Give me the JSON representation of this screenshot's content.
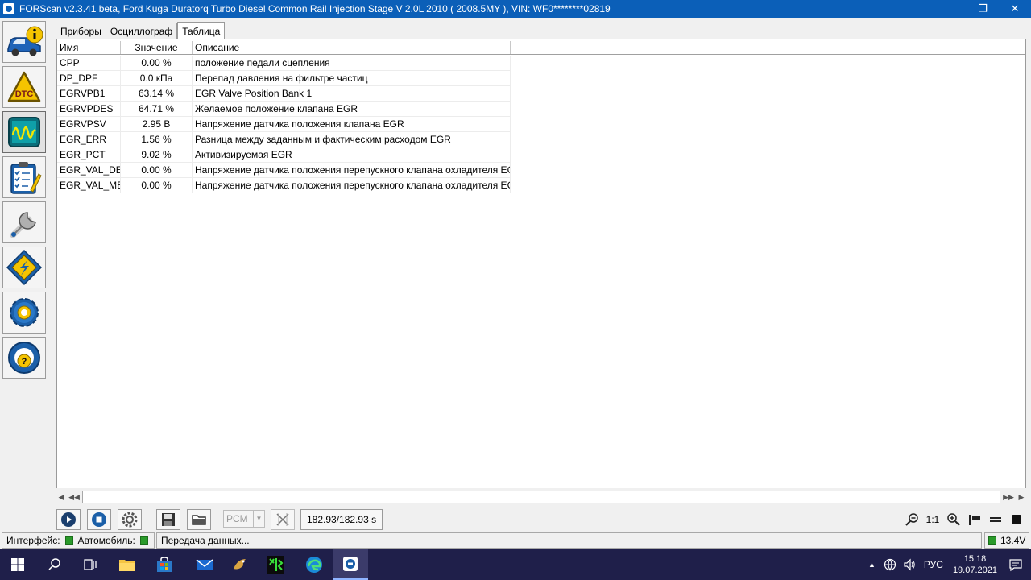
{
  "window": {
    "title": "FORScan v2.3.41 beta, Ford Kuga Duratorq Turbo Diesel Common Rail Injection Stage V 2.0L 2010 ( 2008.5MY ), VIN: WF0********02819",
    "minimize": "–",
    "maximize": "❐",
    "close": "✕"
  },
  "sidebar": {
    "items": [
      {
        "name": "vehicle-info",
        "icon": "car-info-icon"
      },
      {
        "name": "dtc",
        "icon": "dtc-icon",
        "label": "DTC"
      },
      {
        "name": "oscilloscope",
        "icon": "oscilloscope-icon"
      },
      {
        "name": "tests",
        "icon": "checklist-icon"
      },
      {
        "name": "service",
        "icon": "wrench-icon"
      },
      {
        "name": "configuration",
        "icon": "module-chip-icon"
      },
      {
        "name": "settings",
        "icon": "gear-icon"
      },
      {
        "name": "help",
        "icon": "help-icon",
        "label": "?"
      }
    ]
  },
  "tabs": [
    "Приборы",
    "Осциллограф",
    "Таблица"
  ],
  "table": {
    "headers": [
      "Имя",
      "Значение",
      "Описание"
    ],
    "rows": [
      {
        "name": "CPP",
        "value": "0.00 %",
        "desc": "положение педали сцепления"
      },
      {
        "name": "DP_DPF",
        "value": "0.0 кПа",
        "desc": "Перепад давления на фильтре частиц"
      },
      {
        "name": "EGRVPB1",
        "value": "63.14 %",
        "desc": "EGR Valve Position Bank 1"
      },
      {
        "name": "EGRVPDES",
        "value": "64.71 %",
        "desc": "Желаемое положение клапана EGR"
      },
      {
        "name": "EGRVPSV",
        "value": "2.95 В",
        "desc": "Напряжение датчика положения клапана EGR"
      },
      {
        "name": "EGR_ERR",
        "value": "1.56 %",
        "desc": "Разница между заданным и фактическим расходом EGR"
      },
      {
        "name": "EGR_PCT",
        "value": "9.02 %",
        "desc": "Активизируемая EGR"
      },
      {
        "name": "EGR_VAL_DES",
        "value": "0.00 %",
        "desc": "Напряжение датчика положения перепускного клапана охладителя EGR"
      },
      {
        "name": "EGR_VAL_MEA",
        "value": "0.00 %",
        "desc": "Напряжение датчика положения перепускного клапана охладителя EGR"
      }
    ]
  },
  "scrollbar": {
    "left": "◀",
    "rewind": "◀◀",
    "forward": "▶▶",
    "right": "▶"
  },
  "controls": {
    "module_select": "PCM",
    "time_readout": "182.93/182.93 s",
    "zoom_ratio": "1:1"
  },
  "status": {
    "interface_label": "Интерфейс:",
    "vehicle_label": "Автомобиль:",
    "message": "Передача данных...",
    "voltage": "13.4V"
  },
  "taskbar": {
    "language": "РУС",
    "time": "15:18",
    "date": "19.07.2021"
  },
  "colors": {
    "titlebar": "#0b5fb8",
    "status_ok": "#2a9a2a",
    "taskbar": "#1f1f4a"
  }
}
